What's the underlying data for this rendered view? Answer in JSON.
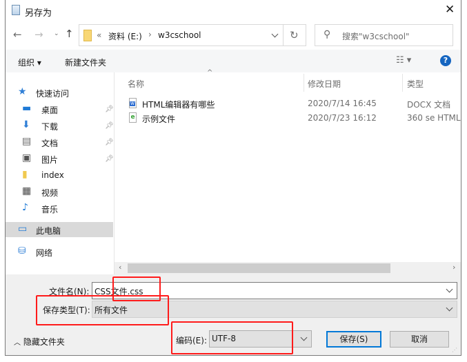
{
  "title": "另存为",
  "close_icon": "close-icon",
  "nav": {
    "path_prefix": "«",
    "path": [
      "资料 (E:)",
      "w3cschool"
    ],
    "search_placeholder": "搜索\"w3cschool\""
  },
  "toolbar": {
    "organize": "组织 ▾",
    "new_folder": "新建文件夹"
  },
  "sidebar": {
    "items": [
      {
        "label": "快速访问",
        "icon": "star-icon"
      },
      {
        "label": "桌面",
        "icon": "desktop-icon",
        "pinned": true
      },
      {
        "label": "下载",
        "icon": "download-icon",
        "pinned": true
      },
      {
        "label": "文档",
        "icon": "document-icon",
        "pinned": true
      },
      {
        "label": "图片",
        "icon": "picture-icon",
        "pinned": true
      },
      {
        "label": "index",
        "icon": "folder-icon"
      },
      {
        "label": "视频",
        "icon": "video-icon"
      },
      {
        "label": "音乐",
        "icon": "music-icon"
      },
      {
        "label": "此电脑",
        "icon": "computer-icon",
        "selected": true
      },
      {
        "label": "网络",
        "icon": "network-icon"
      }
    ]
  },
  "columns": [
    "名称",
    "修改日期",
    "类型"
  ],
  "files": [
    {
      "name": "HTML编辑器有哪些",
      "date": "2020/7/14 16:45",
      "type": "DOCX 文档",
      "icon": "word-doc-icon"
    },
    {
      "name": "示例文件",
      "date": "2020/7/23 16:12",
      "type": "360 se HTML",
      "icon": "html-file-icon"
    }
  ],
  "form": {
    "filename_label": "文件名(N):",
    "filename_value": "CSS文件.css",
    "filetype_label": "保存类型(T):",
    "filetype_value": "所有文件",
    "hide_folders": "隐藏文件夹",
    "encoding_label": "编码(E):",
    "encoding_value": "UTF-8",
    "save": "保存(S)",
    "cancel": "取消"
  },
  "colors": {
    "highlight": "#ff1a1a",
    "selected": "#d9d9d9",
    "accent": "#0078d7"
  }
}
